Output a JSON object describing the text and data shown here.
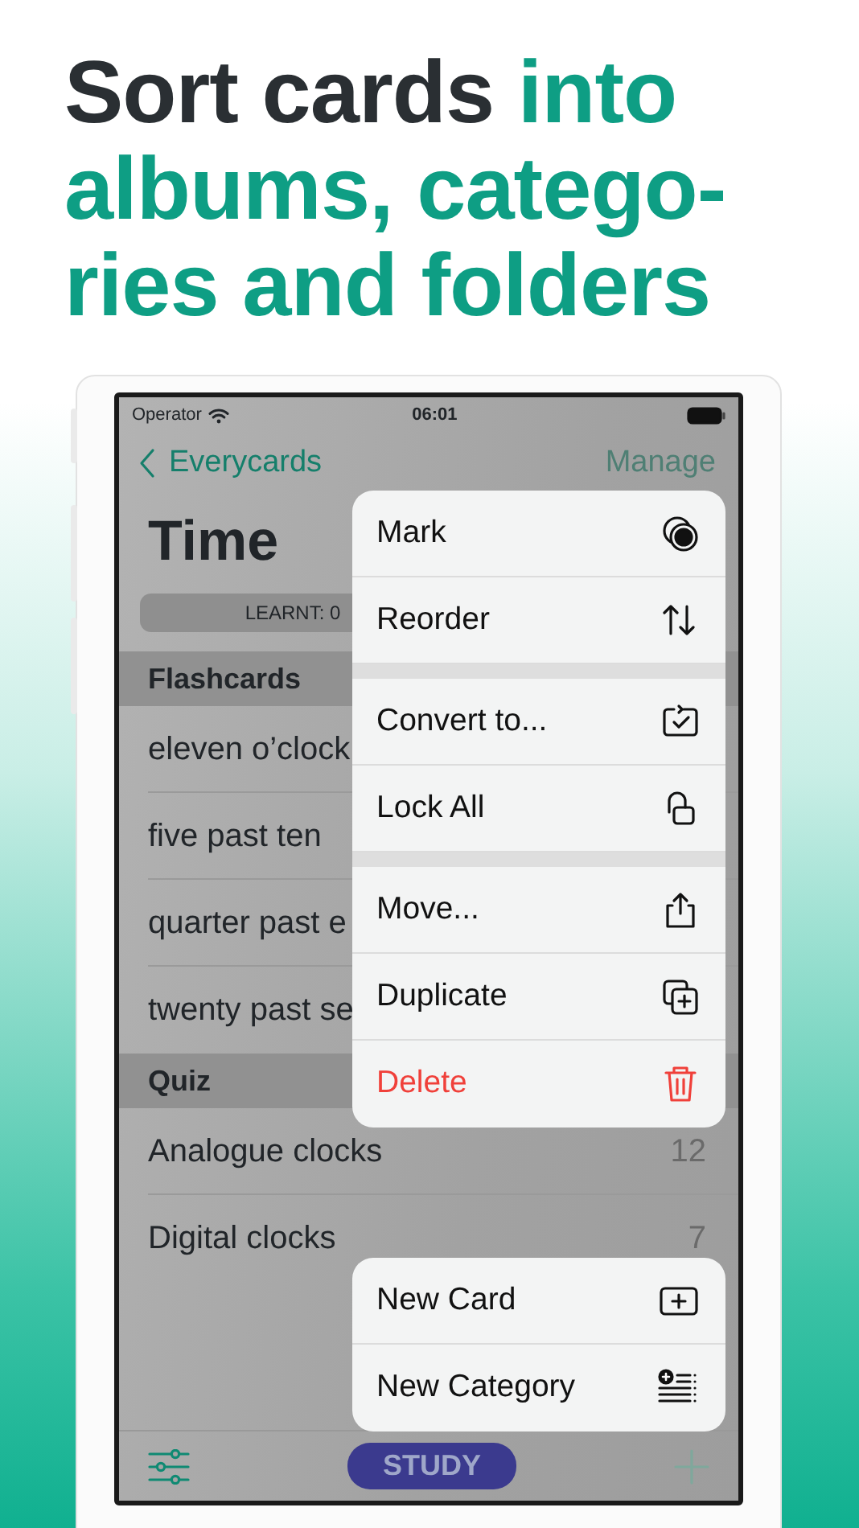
{
  "headline": [
    {
      "text": "Sort cards ",
      "accent": false
    },
    {
      "text": "into\nalbums, catego-\nries and folders",
      "accent": true
    }
  ],
  "status_bar": {
    "carrier": "Operator",
    "time": "06:01"
  },
  "nav": {
    "back": "Everycards",
    "action": "Manage",
    "action_disabled": true
  },
  "title": "Time",
  "learnt": "LEARNT: 0",
  "sections": [
    {
      "header": "Flashcards",
      "rows": [
        {
          "label": "eleven o’clock"
        },
        {
          "label": "five past ten"
        },
        {
          "label": "quarter past e"
        },
        {
          "label": "twenty past se"
        }
      ]
    },
    {
      "header": "Quiz",
      "rows": [
        {
          "label": "Analogue clocks",
          "count": "12"
        },
        {
          "label": "Digital clocks",
          "count": "7"
        }
      ]
    }
  ],
  "context_menu": {
    "groups": [
      [
        {
          "label": "Mark",
          "destructive": false
        },
        {
          "label": "Reorder",
          "destructive": false
        }
      ],
      [
        {
          "label": "Convert to...",
          "destructive": false
        },
        {
          "label": "Lock All",
          "destructive": false
        }
      ],
      [
        {
          "label": "Move...",
          "destructive": false
        },
        {
          "label": "Duplicate",
          "destructive": false
        },
        {
          "label": "Delete",
          "destructive": true
        }
      ]
    ]
  },
  "add_menu": [
    {
      "label": "New Card"
    },
    {
      "label": "New Category"
    }
  ],
  "toolbar": {
    "study": "STUDY"
  }
}
